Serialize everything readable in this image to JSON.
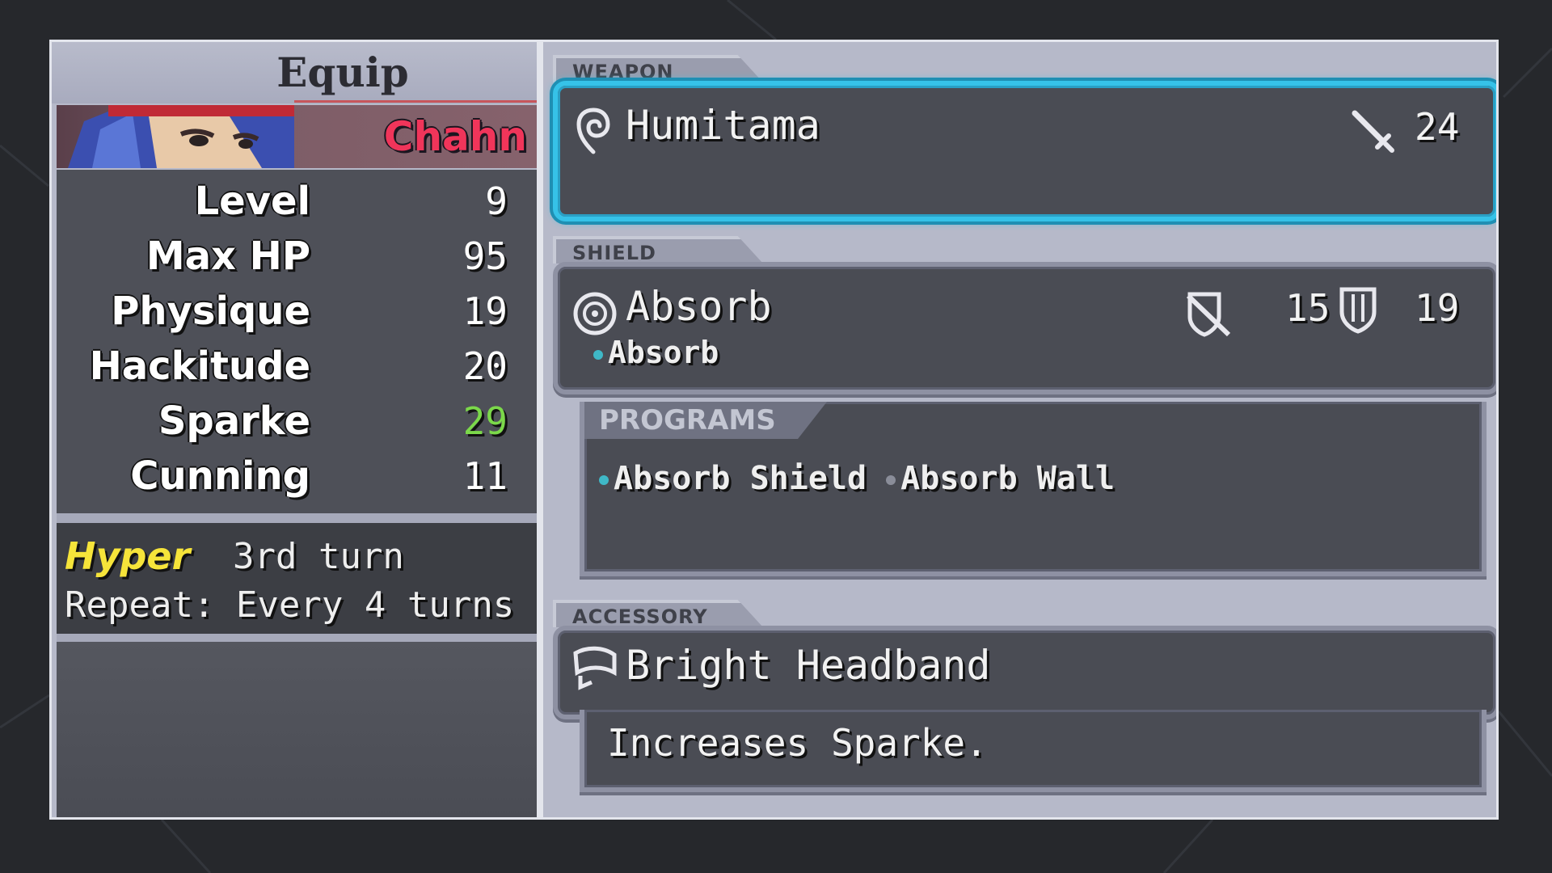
{
  "screen_title": "Equip",
  "character": {
    "name": "Chahn"
  },
  "stats": [
    {
      "label": "Level",
      "value": "9",
      "highlight": false
    },
    {
      "label": "Max HP",
      "value": "95",
      "highlight": false
    },
    {
      "label": "Physique",
      "value": "19",
      "highlight": false
    },
    {
      "label": "Hackitude",
      "value": "20",
      "highlight": false
    },
    {
      "label": "Sparke",
      "value": "29",
      "highlight": true
    },
    {
      "label": "Cunning",
      "value": "11",
      "highlight": false
    }
  ],
  "hyper": {
    "label": "Hyper",
    "turn": "3rd turn",
    "repeat": "Repeat: Every 4 turns"
  },
  "weapon": {
    "tab": "WEAPON",
    "name": "Humitama",
    "attack": "24"
  },
  "shield": {
    "tab": "SHIELD",
    "name": "Absorb",
    "defense": "15",
    "resist": "19",
    "sub": "Absorb",
    "programs_tab": "PROGRAMS",
    "programs": [
      "Absorb Shield",
      "Absorb Wall"
    ]
  },
  "accessory": {
    "tab": "ACCESSORY",
    "name": "Bright Headband",
    "description": "Increases Sparke."
  },
  "colors": {
    "highlight_stat": "#7bd84a",
    "active_border": "#36c2e8",
    "hyper": "#f6e43a",
    "name": "#f0355a"
  },
  "icons": {
    "weapon_type": "spiral-icon",
    "weapon_stat": "sword-icon",
    "shield_type": "ring-icon",
    "shield_stat1": "cross-shield-icon",
    "shield_stat2": "shield-icon",
    "accessory_type": "headband-icon"
  }
}
